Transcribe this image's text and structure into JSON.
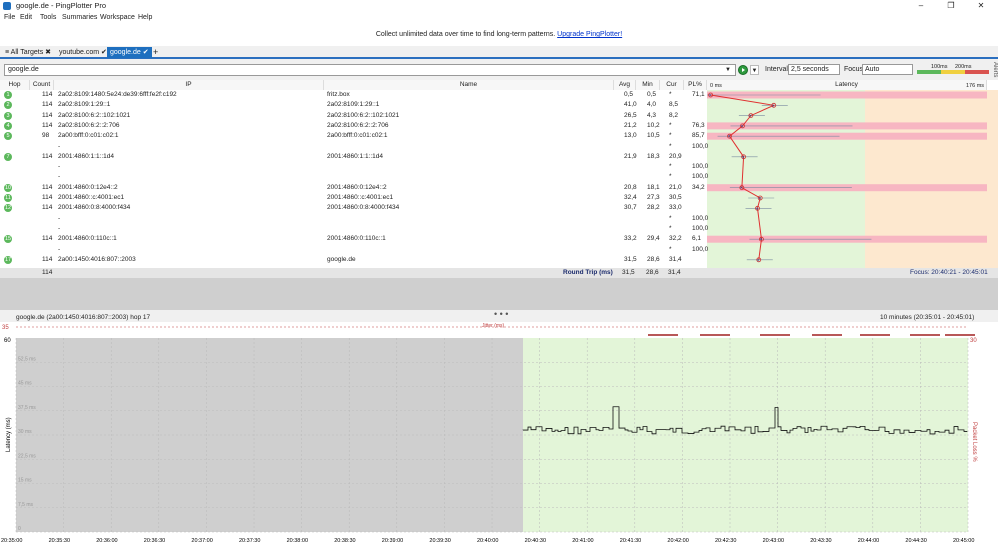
{
  "app": {
    "title": "google.de - PingPlotter Pro",
    "minimize": "–",
    "maximize": "❐",
    "close": "✕"
  },
  "menu": [
    "File",
    "Edit",
    "Tools",
    "Summaries",
    "Workspace",
    "Help"
  ],
  "banner": {
    "text": "Collect unlimited data over time to find long-term patterns.",
    "link": "Upgrade PingPlotter!"
  },
  "tabs": [
    {
      "label": "All Targets",
      "mark": "✖"
    },
    {
      "label": "youtube.com",
      "mark": "✔"
    },
    {
      "label": "google.de",
      "mark": "✔"
    }
  ],
  "new_tab": "+",
  "toolbar": {
    "target": "google.de",
    "interval_label": "Interval",
    "interval_value": "2,5 seconds",
    "focus_label": "Focus",
    "focus_value": "Auto",
    "scale_100": "100ms",
    "scale_200": "200ms",
    "alerts": "Alerts"
  },
  "columns": {
    "hop": "Hop",
    "count": "Count",
    "ip": "IP",
    "name": "Name",
    "avg": "Avg",
    "min": "Min",
    "cur": "Cur",
    "pl": "PL%",
    "latency": "Latency",
    "lat_min": "0 ms",
    "lat_max": "176 ms"
  },
  "rows": [
    {
      "hop": "1",
      "count": "114",
      "ip": "2a02:8109:1480:5e24:de39:6fff:fe2f:c192",
      "name": "fritz.box",
      "avg": "0,5",
      "min": "0,5",
      "cur": "*",
      "pl": "71,1",
      "lat": 1,
      "loss": true
    },
    {
      "hop": "2",
      "count": "114",
      "ip": "2a02:8109:1:29::1",
      "name": "2a02:8109:1:29::1",
      "avg": "41,0",
      "min": "4,0",
      "cur": "8,5",
      "pl": "",
      "lat": 41,
      "loss": false
    },
    {
      "hop": "3",
      "count": "114",
      "ip": "2a02:8100:6:2::102:1021",
      "name": "2a02:8100:6:2::102:1021",
      "avg": "26,5",
      "min": "4,3",
      "cur": "8,2",
      "pl": "",
      "lat": 26.5,
      "loss": false
    },
    {
      "hop": "4",
      "count": "114",
      "ip": "2a02:8100:6:2::2:706",
      "name": "2a02:8100:6:2::2:706",
      "avg": "21,2",
      "min": "10,2",
      "cur": "*",
      "pl": "76,3",
      "lat": 21.2,
      "loss": true
    },
    {
      "hop": "5",
      "count": "98",
      "ip": "2a00:bfff:0:c01:c02:1",
      "name": "2a00:bfff:0:c01:c02:1",
      "avg": "13,0",
      "min": "10,5",
      "cur": "*",
      "pl": "85,7",
      "lat": 13,
      "loss": true
    },
    {
      "hop": "",
      "count": "",
      "ip": "-",
      "name": "",
      "avg": "",
      "min": "",
      "cur": "*",
      "pl": "100,0",
      "lat": null,
      "loss": false
    },
    {
      "hop": "7",
      "count": "114",
      "ip": "2001:4860:1:1::1d4",
      "name": "2001:4860:1:1::1d4",
      "avg": "21,9",
      "min": "18,3",
      "cur": "20,9",
      "pl": "",
      "lat": 21.9,
      "loss": false
    },
    {
      "hop": "",
      "count": "",
      "ip": "-",
      "name": "",
      "avg": "",
      "min": "",
      "cur": "*",
      "pl": "100,0",
      "lat": null,
      "loss": false
    },
    {
      "hop": "",
      "count": "",
      "ip": "-",
      "name": "",
      "avg": "",
      "min": "",
      "cur": "*",
      "pl": "100,0",
      "lat": null,
      "loss": false
    },
    {
      "hop": "10",
      "count": "114",
      "ip": "2001:4860:0:12e4::2",
      "name": "2001:4860:0:12e4::2",
      "avg": "20,8",
      "min": "18,1",
      "cur": "21,0",
      "pl": "34,2",
      "lat": 20.8,
      "loss": true
    },
    {
      "hop": "11",
      "count": "114",
      "ip": "2001:4860::c:4001:ec1",
      "name": "2001:4860::c:4001:ec1",
      "avg": "32,4",
      "min": "27,3",
      "cur": "30,5",
      "pl": "",
      "lat": 32.4,
      "loss": false
    },
    {
      "hop": "12",
      "count": "114",
      "ip": "2001:4860:0:8:4000:f434",
      "name": "2001:4860:0:8:4000:f434",
      "avg": "30,7",
      "min": "28,2",
      "cur": "33,0",
      "pl": "",
      "lat": 30.7,
      "loss": false
    },
    {
      "hop": "",
      "count": "",
      "ip": "-",
      "name": "",
      "avg": "",
      "min": "",
      "cur": "*",
      "pl": "100,0",
      "lat": null,
      "loss": false
    },
    {
      "hop": "",
      "count": "",
      "ip": "-",
      "name": "",
      "avg": "",
      "min": "",
      "cur": "*",
      "pl": "100,0",
      "lat": null,
      "loss": false
    },
    {
      "hop": "15",
      "count": "114",
      "ip": "2001:4860:0:110c::1",
      "name": "2001:4860:0:110c::1",
      "avg": "33,2",
      "min": "29,4",
      "cur": "32,2",
      "pl": "6,1",
      "lat": 33.2,
      "loss": true
    },
    {
      "hop": "",
      "count": "",
      "ip": "-",
      "name": "",
      "avg": "",
      "min": "",
      "cur": "*",
      "pl": "100,0",
      "lat": null,
      "loss": false
    },
    {
      "hop": "17",
      "count": "114",
      "ip": "2a00:1450:4016:807::2003",
      "name": "google.de",
      "avg": "31,5",
      "min": "28,6",
      "cur": "31,4",
      "pl": "",
      "lat": 31.5,
      "loss": false
    }
  ],
  "summary": {
    "count": "114",
    "label": "Round Trip (ms)",
    "avg": "31,5",
    "min": "28,6",
    "cur": "31,4",
    "focus": "Focus: 20:40:21 - 20:45:01"
  },
  "graph": {
    "title": "google.de (2a00:1450:4016:807::2003) hop 17",
    "range": "10 minutes (20:35:01 - 20:45:01)",
    "jitter": "Jitter (ms)",
    "ylabel": "Latency (ms)",
    "y2label": "Packet Loss %",
    "ymax": "60",
    "y2max": "30",
    "jitter_max": "35",
    "yticks": [
      "52,5 ms",
      "45 ms",
      "37,5 ms",
      "30 ms",
      "22,5 ms",
      "15 ms",
      "7,5 ms",
      "0"
    ],
    "xticks": [
      "20:35:00",
      "20:35:30",
      "20:36:00",
      "20:36:30",
      "20:37:00",
      "20:37:30",
      "20:38:00",
      "20:38:30",
      "20:39:00",
      "20:39:30",
      "20:40:00",
      "20:40:30",
      "20:41:00",
      "20:41:30",
      "20:42:00",
      "20:42:30",
      "20:43:00",
      "20:43:30",
      "20:44:00",
      "20:44:30",
      "20:45:00"
    ]
  },
  "colors": {
    "accent": "#1e6fbf",
    "loss": "#f7b6c2",
    "good": "#e3f5d8",
    "warn": "#fde8cf",
    "line": "#e03030"
  }
}
